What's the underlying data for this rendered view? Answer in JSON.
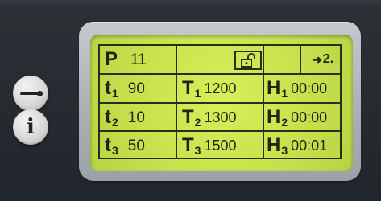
{
  "program": {
    "label": "P",
    "number": "11",
    "lock_icon": "unlocked-padlock-icon",
    "step_indicator": "2.",
    "step_icon": "arrow-right-icon"
  },
  "rows": [
    {
      "t_label": "t",
      "t_sub": "1",
      "t_value": "90",
      "T_label": "T",
      "T_sub": "1",
      "T_value": "1200",
      "H_label": "H",
      "H_sub": "1",
      "H_value": "00:00"
    },
    {
      "t_label": "t",
      "t_sub": "2",
      "t_value": "10",
      "T_label": "T",
      "T_sub": "2",
      "T_value": "1300",
      "H_label": "H",
      "H_sub": "2",
      "H_value": "00:00"
    },
    {
      "t_label": "t",
      "t_sub": "3",
      "t_value": "50",
      "T_label": "T",
      "T_sub": "3",
      "T_value": "1500",
      "H_label": "H",
      "H_sub": "3",
      "H_value": "00:01"
    }
  ],
  "buttons": {
    "minus_icon": "minus-icon",
    "info_icon": "info-icon",
    "info_glyph": "i"
  },
  "colors": {
    "lcd_background": "#c8e24e",
    "lcd_text": "#1f2414",
    "bezel": "#aab1b6",
    "panel": "#252b30"
  }
}
